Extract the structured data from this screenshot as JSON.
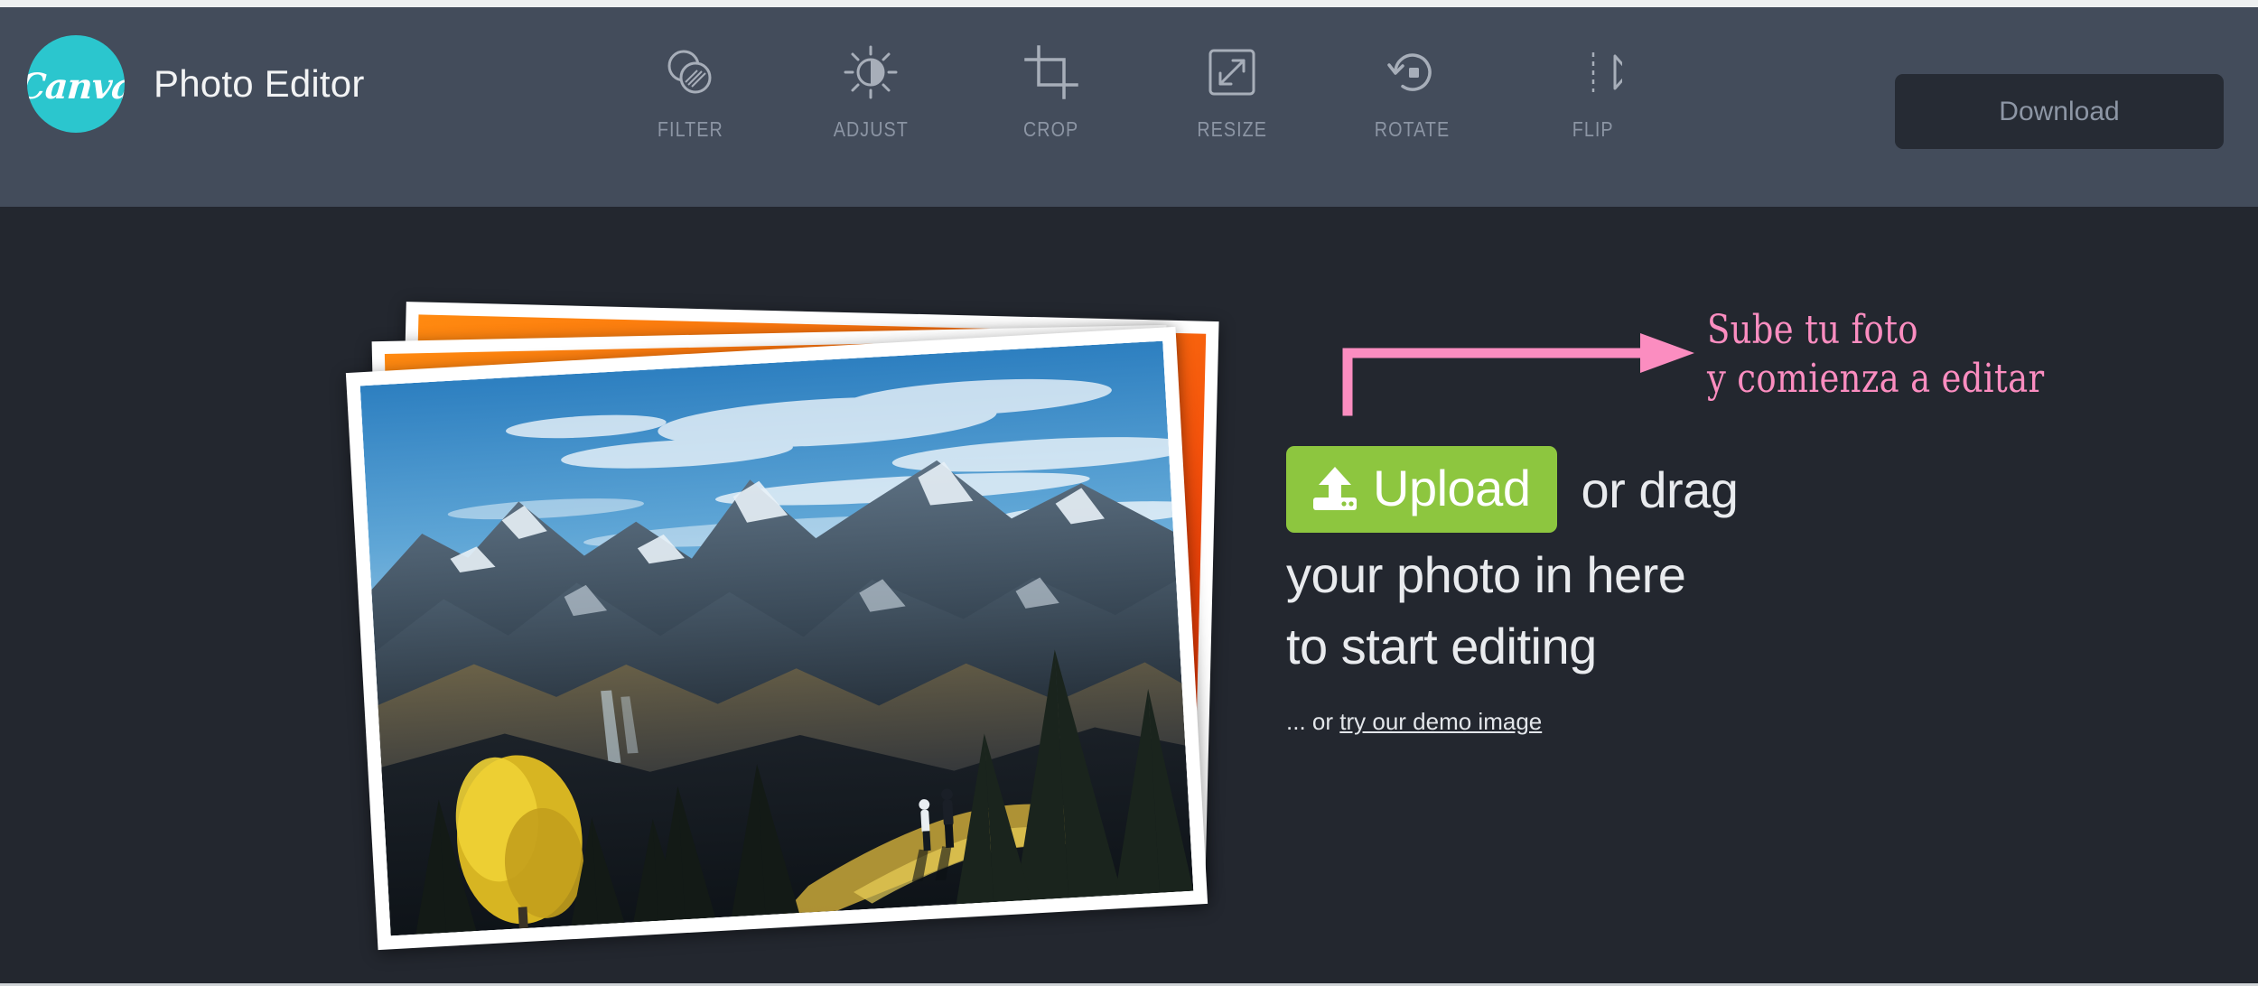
{
  "header": {
    "brand": {
      "logo_text": "Canva",
      "logo_icon": "canva-circle-logo",
      "logo_color": "#2BC6CE",
      "title": "Photo Editor"
    },
    "tools": [
      {
        "label": "FILTER",
        "icon": "filter-circles-icon"
      },
      {
        "label": "ADJUST",
        "icon": "brightness-sun-icon"
      },
      {
        "label": "CROP",
        "icon": "crop-icon"
      },
      {
        "label": "RESIZE",
        "icon": "resize-diagonal-arrows-icon"
      },
      {
        "label": "ROTATE",
        "icon": "rotate-counterclockwise-icon"
      },
      {
        "label": "FLIP",
        "icon": "flip-horizontal-icon"
      }
    ],
    "download_label": "Download",
    "background_color": "#434C5B"
  },
  "main": {
    "background_color": "#23272F",
    "photo_stack": {
      "front_photo_alt": "mountain-landscape-photo",
      "back_photo_alt": "orange-sunset-photo"
    },
    "annotation": {
      "color": "#FB8DC0",
      "line1": "Sube tu foto",
      "line2": "y comienza a editar",
      "arrow_icon": "elbow-arrow-right-icon"
    },
    "upload": {
      "button_label": "Upload",
      "button_icon": "upload-arrow-icon",
      "button_color": "#8DC63F",
      "or_drag": "or drag",
      "line2": "your photo in here",
      "line3": "to start editing",
      "demo_prefix": "... or ",
      "demo_link": "try our demo image"
    }
  }
}
